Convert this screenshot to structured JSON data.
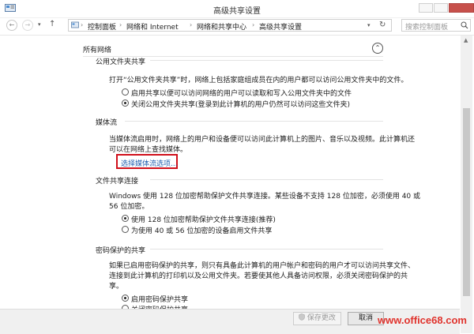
{
  "window": {
    "title": "高级共享设置",
    "minimize_glyph": "—",
    "maximize_glyph": "□",
    "close_glyph": "✕"
  },
  "nav": {
    "back_glyph": "←",
    "forward_glyph": "→",
    "up_glyph": "↑",
    "breadcrumbs": [
      "控制面板",
      "网络和 Internet",
      "网络和共享中心",
      "高级共享设置"
    ],
    "search_placeholder": "搜索控制面板"
  },
  "content": {
    "section_title": "所有网络",
    "collapse_glyph": "⌃",
    "public_folder": {
      "title": "公用文件夹共享",
      "description": "打开“公用文件夹共享”时，网络上包括家庭组成员在内的用户都可以访问公用文件夹中的文件。",
      "options": [
        {
          "label": "启用共享以便可以访问网络的用户可以读取和写入公用文件夹中的文件",
          "selected": false
        },
        {
          "label": "关闭公用文件夹共享(登录到此计算机的用户仍然可以访问这些文件夹)",
          "selected": true
        }
      ]
    },
    "media_stream": {
      "title": "媒体流",
      "description_line1": "当媒体流启用时，网络上的用户和设备便可以访问此计算机上的图片、音乐以及视频。此计算机还",
      "description_line2": "可以在网络上查找媒体。",
      "link": "选择媒体流选项..."
    },
    "file_sharing": {
      "title": "文件共享连接",
      "description_line1": "Windows 使用 128 位加密帮助保护文件共享连接。某些设备不支持 128 位加密，必须使用 40 或",
      "description_line2": "56 位加密。",
      "options": [
        {
          "label": "使用 128 位加密帮助保护文件共享连接(推荐)",
          "selected": true
        },
        {
          "label": "为使用 40 或 56 位加密的设备启用文件共享",
          "selected": false
        }
      ]
    },
    "password_sharing": {
      "title": "密码保护的共享",
      "description_line1": "如果已启用密码保护的共享，则只有具备此计算机的用户帐户和密码的用户才可以访问共享文件、",
      "description_line2": "连接到此计算机的打印机以及公用文件夹。若要使其他人具备访问权限，必须关闭密码保护的共",
      "description_line3": "享。",
      "options": [
        {
          "label": "启用密码保护共享",
          "selected": true
        },
        {
          "label": "关闭密码保护共享",
          "selected": false
        }
      ]
    }
  },
  "footer": {
    "save_label": "保存更改",
    "cancel_label": "取消"
  },
  "watermark": "www.office68.com",
  "colors": {
    "highlight_box": "#d0101b",
    "link": "#1f5fb0",
    "watermark": "#e0332d"
  }
}
